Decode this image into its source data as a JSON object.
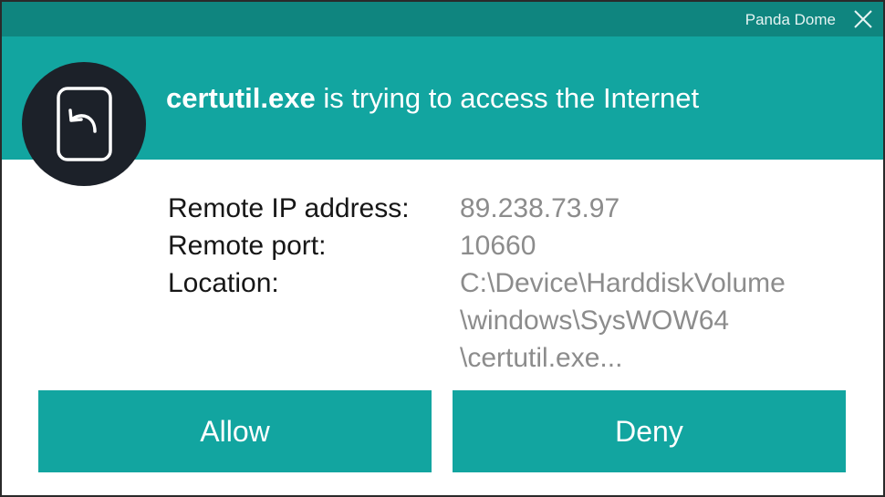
{
  "window": {
    "app_title": "Panda Dome"
  },
  "header": {
    "process_name": "certutil.exe",
    "message": " is trying to access the Internet"
  },
  "icons": {
    "app_icon": "return-arrow-document-icon",
    "close_icon": "close-icon"
  },
  "details": {
    "remote_ip_label": "Remote IP address:",
    "remote_ip_value": "89.238.73.97",
    "remote_port_label": "Remote port:",
    "remote_port_value": "10660",
    "location_label": "Location:",
    "location_lines": [
      "C:\\Device\\HarddiskVolume",
      "\\windows\\SysWOW64",
      "\\certutil.exe..."
    ]
  },
  "actions": {
    "allow_label": "Allow",
    "deny_label": "Deny"
  },
  "colors": {
    "titlebar": "#0f857f",
    "header": "#12a5a0",
    "button": "#12a5a0",
    "icon_circle": "#1c2129",
    "value_text": "#8c8c8c"
  }
}
